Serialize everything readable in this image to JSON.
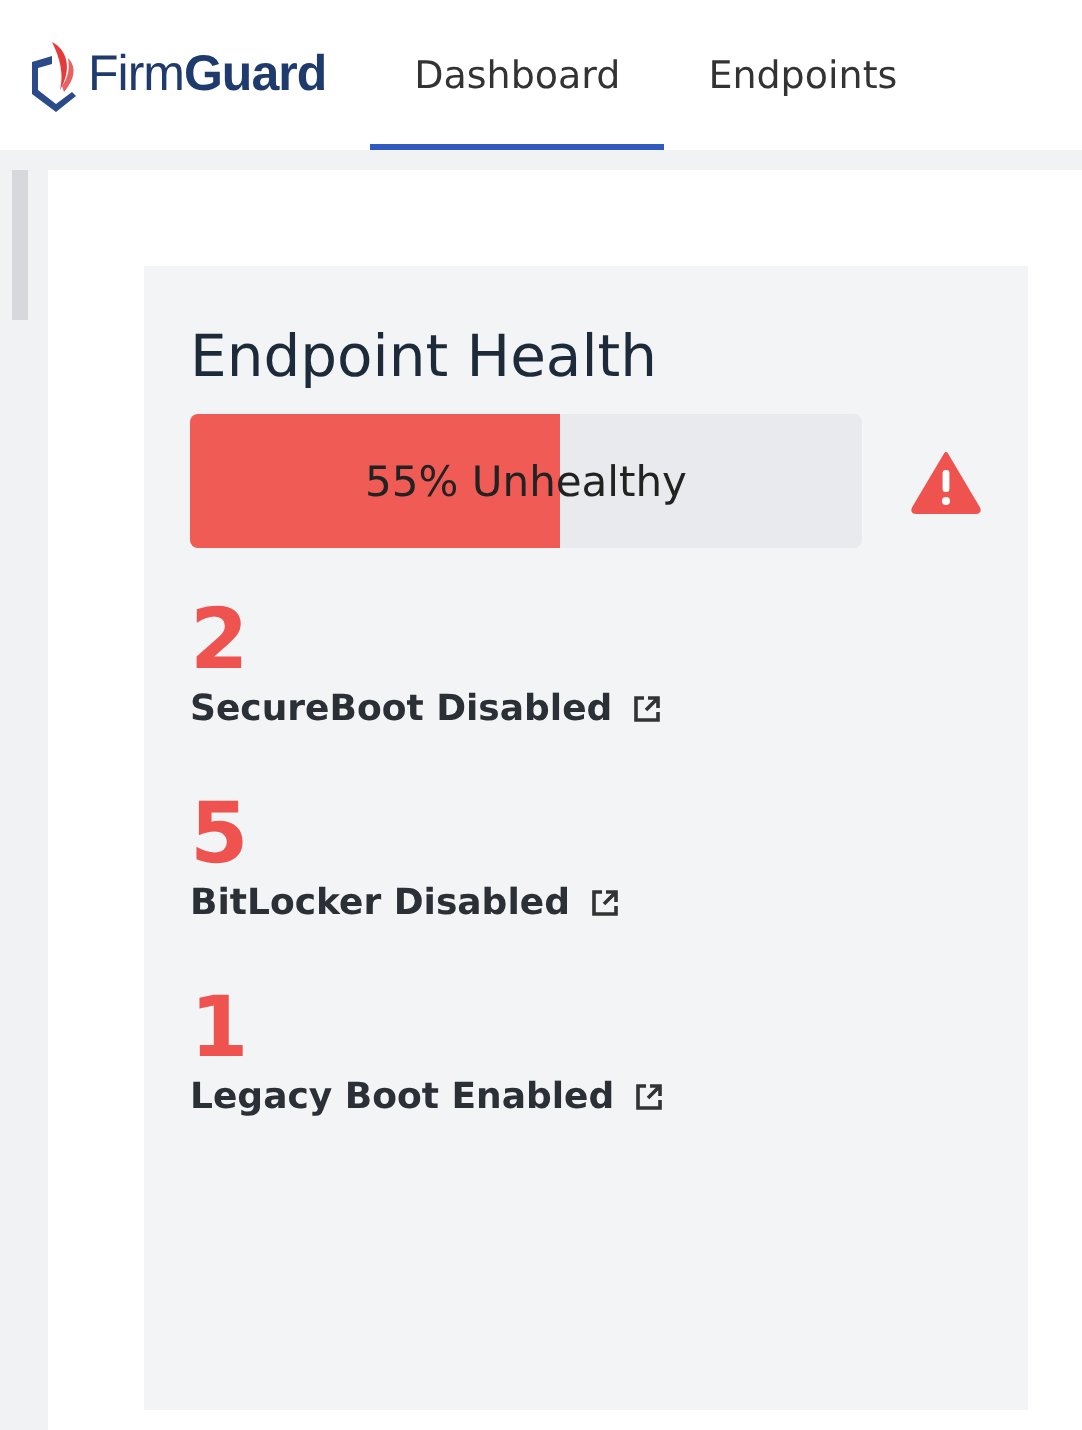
{
  "header": {
    "logo": "Firm**Guard**",
    "tabs": [
      {
        "label": "Dashboard",
        "selected": true
      },
      {
        "label": "Endpoints",
        "selected": false
      }
    ]
  },
  "card": {
    "title": "Endpoint Health",
    "health": {
      "level": 0.55,
      "label": "55% Unhealthy",
      "warning": true
    },
    "stats": [
      {
        "count": "2",
        "label": "SecureBoot Disabled"
      },
      {
        "count": "5",
        "label": "BitLocker Disabled"
      },
      {
        "count": "1",
        "label": "Legacy Boot Enabled"
      }
    ]
  }
}
